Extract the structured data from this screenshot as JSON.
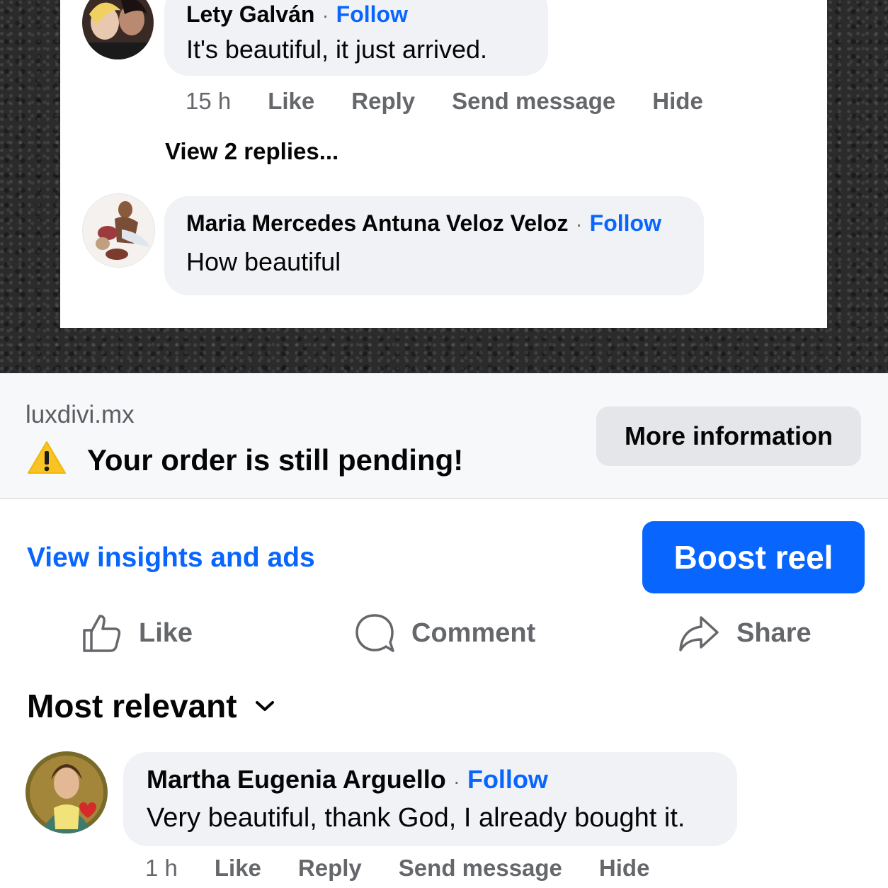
{
  "top_comments": [
    {
      "name": "Lety Galván",
      "separator": "·",
      "follow": "Follow",
      "text": "It's beautiful, it just arrived.",
      "time": "15 h",
      "like": "Like",
      "reply": "Reply",
      "send_message": "Send message",
      "hide": "Hide",
      "view_replies": "View 2 replies..."
    },
    {
      "name": "Maria Mercedes Antuna Veloz Veloz",
      "separator": "·",
      "follow": "Follow",
      "text": "How beautiful"
    }
  ],
  "ad": {
    "domain": "luxdivi.mx",
    "warning_icon": "warning-triangle-icon",
    "message": "Your order is still pending!",
    "button": "More information"
  },
  "insights": {
    "link": "View insights and ads",
    "boost_button": "Boost reel"
  },
  "action_bar": {
    "like": "Like",
    "comment": "Comment",
    "share": "Share"
  },
  "sort": {
    "label": "Most relevant"
  },
  "comment": {
    "name": "Martha Eugenia Arguello",
    "separator": "·",
    "follow": "Follow",
    "text": "Very beautiful, thank God, I already bought it.",
    "time": "1 h",
    "like": "Like",
    "reply": "Reply",
    "send_message": "Send message",
    "hide": "Hide"
  },
  "colors": {
    "accent_blue": "#0866ff",
    "bubble_gray": "#f0f2f5",
    "secondary_text": "#65676b",
    "warning_yellow": "#f7c325"
  }
}
